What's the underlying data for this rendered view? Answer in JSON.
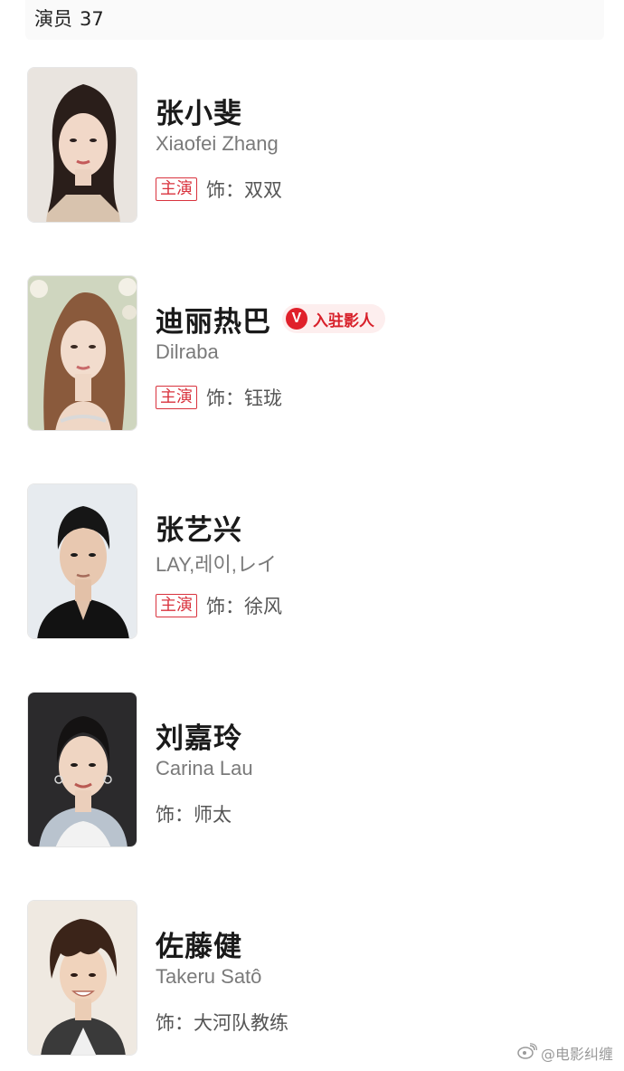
{
  "header": {
    "label": "演员",
    "count": "37"
  },
  "cast": [
    {
      "name": "张小斐",
      "alt_name": "Xiaofei Zhang",
      "tag": "主演",
      "role_prefix": "饰：",
      "role": "双双",
      "verified": false
    },
    {
      "name": "迪丽热巴",
      "alt_name": "Dilraba",
      "tag": "主演",
      "role_prefix": "饰：",
      "role": "钰珑",
      "verified": true,
      "verified_label": "入驻影人",
      "verified_icon_text": "V"
    },
    {
      "name": "张艺兴",
      "alt_name": "LAY,레이,レイ",
      "tag": "主演",
      "role_prefix": "饰：",
      "role": "徐风",
      "verified": false
    },
    {
      "name": "刘嘉玲",
      "alt_name": "Carina Lau",
      "tag": "",
      "role_prefix": "饰：",
      "role": "师太",
      "verified": false
    },
    {
      "name": "佐藤健",
      "alt_name": "Takeru Satô",
      "tag": "",
      "role_prefix": "饰：",
      "role": "大河队教练",
      "verified": false
    }
  ],
  "watermark": {
    "text": "@电影纠缠",
    "icon": "weibo-icon"
  },
  "colors": {
    "accent_red": "#d9333e",
    "badge_bg": "#fdeeee",
    "text_primary": "#1a1a1a",
    "text_secondary": "#7a7a7a"
  }
}
